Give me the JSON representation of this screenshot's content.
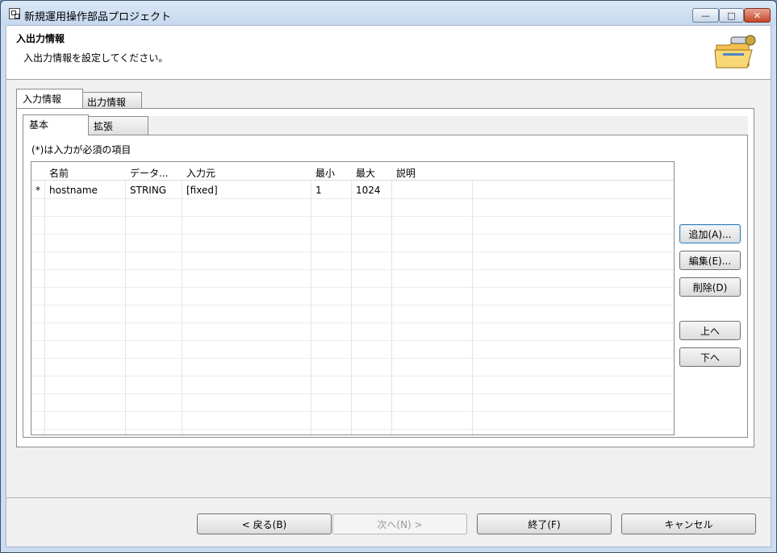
{
  "window": {
    "title": "新規運用操作部品プロジェクト",
    "controls": {
      "minimize": "—",
      "maximize": "□",
      "close": "✕"
    }
  },
  "banner": {
    "title": "入出力情報",
    "description": "入出力情報を設定してください。",
    "icon": "folder-icon"
  },
  "outer_tabs": [
    {
      "label": "入力情報"
    },
    {
      "label": "出力情報"
    }
  ],
  "inner_tabs": [
    {
      "label": "基本"
    },
    {
      "label": "拡張"
    }
  ],
  "required_note": "(*)は入力が必須の項目",
  "table": {
    "columns": [
      "名前",
      "データ...",
      "入力元",
      "最小",
      "最大",
      "説明"
    ],
    "rows": [
      {
        "marker": "*",
        "name": "hostname",
        "type": "STRING",
        "source": "[fixed]",
        "min": "1",
        "max": "1024",
        "desc": ""
      }
    ]
  },
  "side_buttons": {
    "add": "追加(A)...",
    "edit": "編集(E)...",
    "delete": "削除(D)",
    "up": "上へ",
    "down": "下へ"
  },
  "nav_buttons": {
    "back": "< 戻る(B)",
    "next": "次へ(N) >",
    "finish": "終了(F)",
    "cancel": "キャンセル"
  }
}
